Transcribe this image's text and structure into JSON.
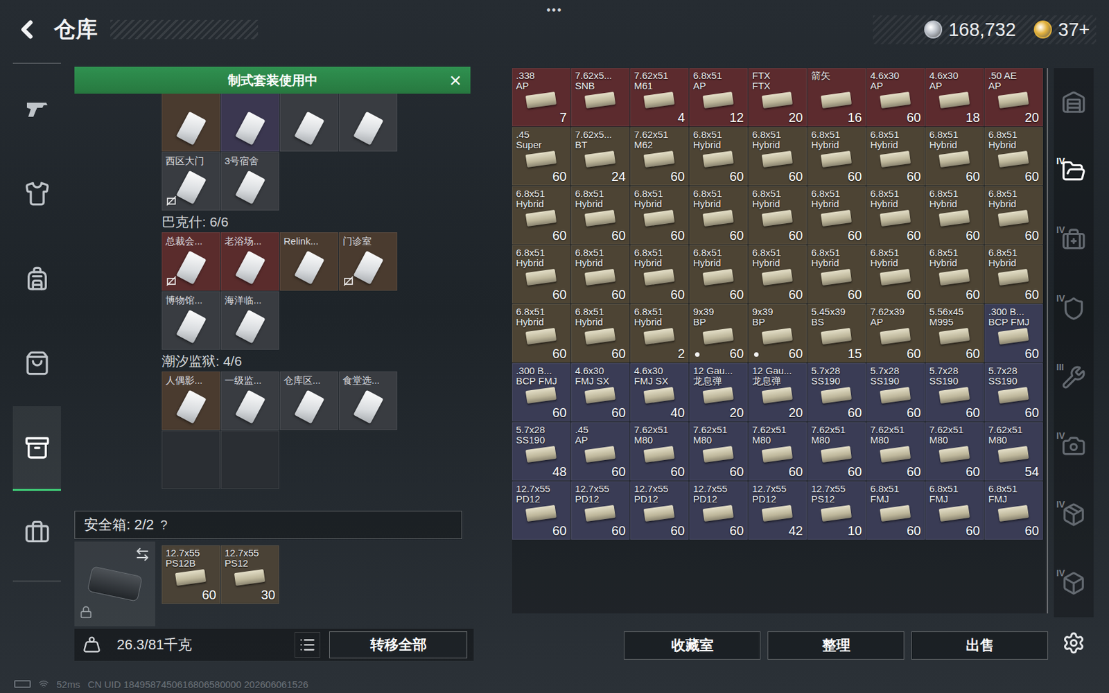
{
  "header": {
    "title": "仓库",
    "menu": "•••",
    "currencies": [
      {
        "amount": "168,732",
        "color": "#b9bec6"
      },
      {
        "amount": "37+",
        "color": "#e2b13c"
      }
    ]
  },
  "nav": [
    {
      "selected": false
    },
    {
      "selected": false
    },
    {
      "selected": false
    },
    {
      "selected": false
    },
    {
      "selected": true
    },
    {
      "selected": false
    }
  ],
  "banner": {
    "text": "制式套装使用中",
    "close": "×"
  },
  "key_groups": [
    {
      "title": "",
      "keys": [
        {
          "name": "",
          "kind": "key",
          "bound": false,
          "color": "#4a3b2f"
        },
        {
          "name": "",
          "kind": "key",
          "bound": false,
          "color": "#3b3750"
        },
        {
          "name": "",
          "kind": "key",
          "bound": false,
          "color": "#393c41"
        },
        {
          "name": "",
          "kind": "key",
          "bound": false,
          "color": "#393c41"
        },
        {
          "name": "西区大门",
          "kind": "key",
          "bound": true,
          "color": "#393c41"
        },
        {
          "name": "3号宿舍",
          "kind": "key",
          "bound": false,
          "color": "#393c41"
        }
      ]
    },
    {
      "title": "巴克什: 6/6",
      "keys": [
        {
          "name": "总裁会...",
          "kind": "key",
          "bound": true,
          "color": "#5a2c2c"
        },
        {
          "name": "老浴场...",
          "kind": "key",
          "bound": false,
          "color": "#5a2c2c"
        },
        {
          "name": "Relink...",
          "kind": "key",
          "bound": false,
          "color": "#4a3b2f"
        },
        {
          "name": "门诊室",
          "kind": "key",
          "bound": true,
          "color": "#4a3b2f"
        },
        {
          "name": "博物馆...",
          "kind": "key",
          "bound": false,
          "color": "#393c41"
        },
        {
          "name": "海洋临...",
          "kind": "key",
          "bound": false,
          "color": "#393c41"
        }
      ]
    },
    {
      "title": "潮汐监狱: 4/6",
      "keys": [
        {
          "name": "人偶影...",
          "kind": "key",
          "bound": false,
          "color": "#4a3b2f"
        },
        {
          "name": "一级监...",
          "kind": "key",
          "bound": false,
          "color": "#393c41"
        },
        {
          "name": "仓库区...",
          "kind": "key",
          "bound": false,
          "color": "#393c41"
        },
        {
          "name": "食堂选...",
          "kind": "key",
          "bound": false,
          "color": "#393c41"
        },
        {
          "name": "",
          "kind": "empty",
          "bound": false,
          "color": "#2a2e33"
        },
        {
          "name": "",
          "kind": "empty",
          "bound": false,
          "color": "#2a2e33"
        }
      ]
    }
  ],
  "safe_box": {
    "label": "安全箱: 2/2",
    "help": "?",
    "items": [
      {
        "caliber": "12.7x55",
        "type": "PS12B",
        "count": "60",
        "color": "#4a4236",
        "marked": false
      },
      {
        "caliber": "12.7x55",
        "type": "PS12",
        "count": "30",
        "color": "#4a4236",
        "marked": false
      }
    ]
  },
  "weight": "26.3/81千克",
  "transfer_button": "转移全部",
  "stash": {
    "items": [
      {
        "caliber": ".338",
        "type": "AP",
        "count": "7",
        "color": "#5c2b2e",
        "marked": false
      },
      {
        "caliber": "7.62x5...",
        "type": "SNB",
        "count": "",
        "color": "#5c2b2e",
        "marked": false
      },
      {
        "caliber": "7.62x51",
        "type": "M61",
        "count": "4",
        "color": "#5c2b2e",
        "marked": false
      },
      {
        "caliber": "6.8x51",
        "type": "AP",
        "count": "12",
        "color": "#5c2b2e",
        "marked": false
      },
      {
        "caliber": "FTX",
        "type": "FTX",
        "count": "20",
        "color": "#5c2b2e",
        "marked": false
      },
      {
        "caliber": "箭矢",
        "type": "",
        "count": "16",
        "color": "#5c2b2e",
        "marked": false
      },
      {
        "caliber": "4.6x30",
        "type": "AP",
        "count": "60",
        "color": "#5c2b2e",
        "marked": false
      },
      {
        "caliber": "4.6x30",
        "type": "AP",
        "count": "18",
        "color": "#5c2b2e",
        "marked": false
      },
      {
        "caliber": ".50 AE",
        "type": "AP",
        "count": "20",
        "color": "#5c2b2e",
        "marked": false
      },
      {
        "caliber": ".45",
        "type": "Super",
        "count": "60",
        "color": "#4d4434",
        "marked": false
      },
      {
        "caliber": "7.62x5...",
        "type": "BT",
        "count": "24",
        "color": "#4d4434",
        "marked": false
      },
      {
        "caliber": "7.62x51",
        "type": "M62",
        "count": "60",
        "color": "#4d4434",
        "marked": false
      },
      {
        "caliber": "6.8x51",
        "type": "Hybrid",
        "count": "60",
        "color": "#4d4434",
        "marked": false
      },
      {
        "caliber": "6.8x51",
        "type": "Hybrid",
        "count": "60",
        "color": "#4d4434",
        "marked": false
      },
      {
        "caliber": "6.8x51",
        "type": "Hybrid",
        "count": "60",
        "color": "#4d4434",
        "marked": false
      },
      {
        "caliber": "6.8x51",
        "type": "Hybrid",
        "count": "60",
        "color": "#4d4434",
        "marked": false
      },
      {
        "caliber": "6.8x51",
        "type": "Hybrid",
        "count": "60",
        "color": "#4d4434",
        "marked": false
      },
      {
        "caliber": "6.8x51",
        "type": "Hybrid",
        "count": "60",
        "color": "#4d4434",
        "marked": false
      },
      {
        "caliber": "6.8x51",
        "type": "Hybrid",
        "count": "60",
        "color": "#4d4434",
        "marked": false
      },
      {
        "caliber": "6.8x51",
        "type": "Hybrid",
        "count": "60",
        "color": "#4d4434",
        "marked": false
      },
      {
        "caliber": "6.8x51",
        "type": "Hybrid",
        "count": "60",
        "color": "#4d4434",
        "marked": false
      },
      {
        "caliber": "6.8x51",
        "type": "Hybrid",
        "count": "60",
        "color": "#4d4434",
        "marked": false
      },
      {
        "caliber": "6.8x51",
        "type": "Hybrid",
        "count": "60",
        "color": "#4d4434",
        "marked": false
      },
      {
        "caliber": "6.8x51",
        "type": "Hybrid",
        "count": "60",
        "color": "#4d4434",
        "marked": false
      },
      {
        "caliber": "6.8x51",
        "type": "Hybrid",
        "count": "60",
        "color": "#4d4434",
        "marked": false
      },
      {
        "caliber": "6.8x51",
        "type": "Hybrid",
        "count": "60",
        "color": "#4d4434",
        "marked": false
      },
      {
        "caliber": "6.8x51",
        "type": "Hybrid",
        "count": "60",
        "color": "#4d4434",
        "marked": false
      },
      {
        "caliber": "6.8x51",
        "type": "Hybrid",
        "count": "60",
        "color": "#4d4434",
        "marked": false
      },
      {
        "caliber": "6.8x51",
        "type": "Hybrid",
        "count": "60",
        "color": "#4d4434",
        "marked": false
      },
      {
        "caliber": "6.8x51",
        "type": "Hybrid",
        "count": "60",
        "color": "#4d4434",
        "marked": false
      },
      {
        "caliber": "6.8x51",
        "type": "Hybrid",
        "count": "60",
        "color": "#4d4434",
        "marked": false
      },
      {
        "caliber": "6.8x51",
        "type": "Hybrid",
        "count": "60",
        "color": "#4d4434",
        "marked": false
      },
      {
        "caliber": "6.8x51",
        "type": "Hybrid",
        "count": "60",
        "color": "#4d4434",
        "marked": false
      },
      {
        "caliber": "6.8x51",
        "type": "Hybrid",
        "count": "60",
        "color": "#4d4434",
        "marked": false
      },
      {
        "caliber": "6.8x51",
        "type": "Hybrid",
        "count": "60",
        "color": "#4d4434",
        "marked": false
      },
      {
        "caliber": "6.8x51",
        "type": "Hybrid",
        "count": "60",
        "color": "#4d4434",
        "marked": false
      },
      {
        "caliber": "6.8x51",
        "type": "Hybrid",
        "count": "60",
        "color": "#4d4434",
        "marked": false
      },
      {
        "caliber": "6.8x51",
        "type": "Hybrid",
        "count": "60",
        "color": "#4d4434",
        "marked": false
      },
      {
        "caliber": "6.8x51",
        "type": "Hybrid",
        "count": "2",
        "color": "#4d4434",
        "marked": false
      },
      {
        "caliber": "9x39",
        "type": "BP",
        "count": "60",
        "color": "#4d4434",
        "marked": true
      },
      {
        "caliber": "9x39",
        "type": "BP",
        "count": "60",
        "color": "#4d4434",
        "marked": true
      },
      {
        "caliber": "5.45x39",
        "type": "BS",
        "count": "15",
        "color": "#4d4434",
        "marked": false
      },
      {
        "caliber": "7.62x39",
        "type": "AP",
        "count": "60",
        "color": "#4d4434",
        "marked": false
      },
      {
        "caliber": "5.56x45",
        "type": "M995",
        "count": "60",
        "color": "#4d4434",
        "marked": false
      },
      {
        "caliber": ".300 B...",
        "type": "BCP FMJ",
        "count": "60",
        "color": "#3a3c55",
        "marked": false
      },
      {
        "caliber": ".300 B...",
        "type": "BCP FMJ",
        "count": "60",
        "color": "#3a3c55",
        "marked": false
      },
      {
        "caliber": "4.6x30",
        "type": "FMJ SX",
        "count": "60",
        "color": "#3a3c55",
        "marked": false
      },
      {
        "caliber": "4.6x30",
        "type": "FMJ SX",
        "count": "40",
        "color": "#3a3c55",
        "marked": false
      },
      {
        "caliber": "12 Gau...",
        "type": "龙息弹",
        "count": "20",
        "color": "#3a3c55",
        "marked": false
      },
      {
        "caliber": "12 Gau...",
        "type": "龙息弹",
        "count": "20",
        "color": "#3a3c55",
        "marked": false
      },
      {
        "caliber": "5.7x28",
        "type": "SS190",
        "count": "60",
        "color": "#3a3c55",
        "marked": false
      },
      {
        "caliber": "5.7x28",
        "type": "SS190",
        "count": "60",
        "color": "#3a3c55",
        "marked": false
      },
      {
        "caliber": "5.7x28",
        "type": "SS190",
        "count": "60",
        "color": "#3a3c55",
        "marked": false
      },
      {
        "caliber": "5.7x28",
        "type": "SS190",
        "count": "60",
        "color": "#3a3c55",
        "marked": false
      },
      {
        "caliber": "5.7x28",
        "type": "SS190",
        "count": "48",
        "color": "#3a3c55",
        "marked": false
      },
      {
        "caliber": ".45",
        "type": "AP",
        "count": "60",
        "color": "#3a3c55",
        "marked": false
      },
      {
        "caliber": "7.62x51",
        "type": "M80",
        "count": "60",
        "color": "#3a3c55",
        "marked": false
      },
      {
        "caliber": "7.62x51",
        "type": "M80",
        "count": "60",
        "color": "#3a3c55",
        "marked": false
      },
      {
        "caliber": "7.62x51",
        "type": "M80",
        "count": "60",
        "color": "#3a3c55",
        "marked": false
      },
      {
        "caliber": "7.62x51",
        "type": "M80",
        "count": "60",
        "color": "#3a3c55",
        "marked": false
      },
      {
        "caliber": "7.62x51",
        "type": "M80",
        "count": "60",
        "color": "#3a3c55",
        "marked": false
      },
      {
        "caliber": "7.62x51",
        "type": "M80",
        "count": "60",
        "color": "#3a3c55",
        "marked": false
      },
      {
        "caliber": "7.62x51",
        "type": "M80",
        "count": "54",
        "color": "#3a3c55",
        "marked": false
      },
      {
        "caliber": "12.7x55",
        "type": "PD12",
        "count": "60",
        "color": "#3a3c55",
        "marked": false
      },
      {
        "caliber": "12.7x55",
        "type": "PD12",
        "count": "60",
        "color": "#3a3c55",
        "marked": false
      },
      {
        "caliber": "12.7x55",
        "type": "PD12",
        "count": "60",
        "color": "#3a3c55",
        "marked": false
      },
      {
        "caliber": "12.7x55",
        "type": "PD12",
        "count": "60",
        "color": "#3a3c55",
        "marked": false
      },
      {
        "caliber": "12.7x55",
        "type": "PD12",
        "count": "42",
        "color": "#3a3c55",
        "marked": false
      },
      {
        "caliber": "12.7x55",
        "type": "PS12",
        "count": "10",
        "color": "#3a3c55",
        "marked": false
      },
      {
        "caliber": "6.8x51",
        "type": "FMJ",
        "count": "60",
        "color": "#3a3c55",
        "marked": false
      },
      {
        "caliber": "6.8x51",
        "type": "FMJ",
        "count": "60",
        "color": "#3a3c55",
        "marked": false
      },
      {
        "caliber": "6.8x51",
        "type": "FMJ",
        "count": "60",
        "color": "#3a3c55",
        "marked": false
      }
    ]
  },
  "side_tabs": [
    {
      "label": "",
      "selected": false
    },
    {
      "label": "IV",
      "selected": true
    },
    {
      "label": "IV",
      "selected": false
    },
    {
      "label": "IV",
      "selected": false
    },
    {
      "label": "III",
      "selected": false
    },
    {
      "label": "IV",
      "selected": false
    },
    {
      "label": "IV",
      "selected": false
    },
    {
      "label": "IV",
      "selected": false
    }
  ],
  "actions": [
    "收藏室",
    "整理",
    "出售"
  ],
  "status": {
    "ping": "52ms",
    "uid": "CN UID 1849587450616806580000 202606061526"
  }
}
